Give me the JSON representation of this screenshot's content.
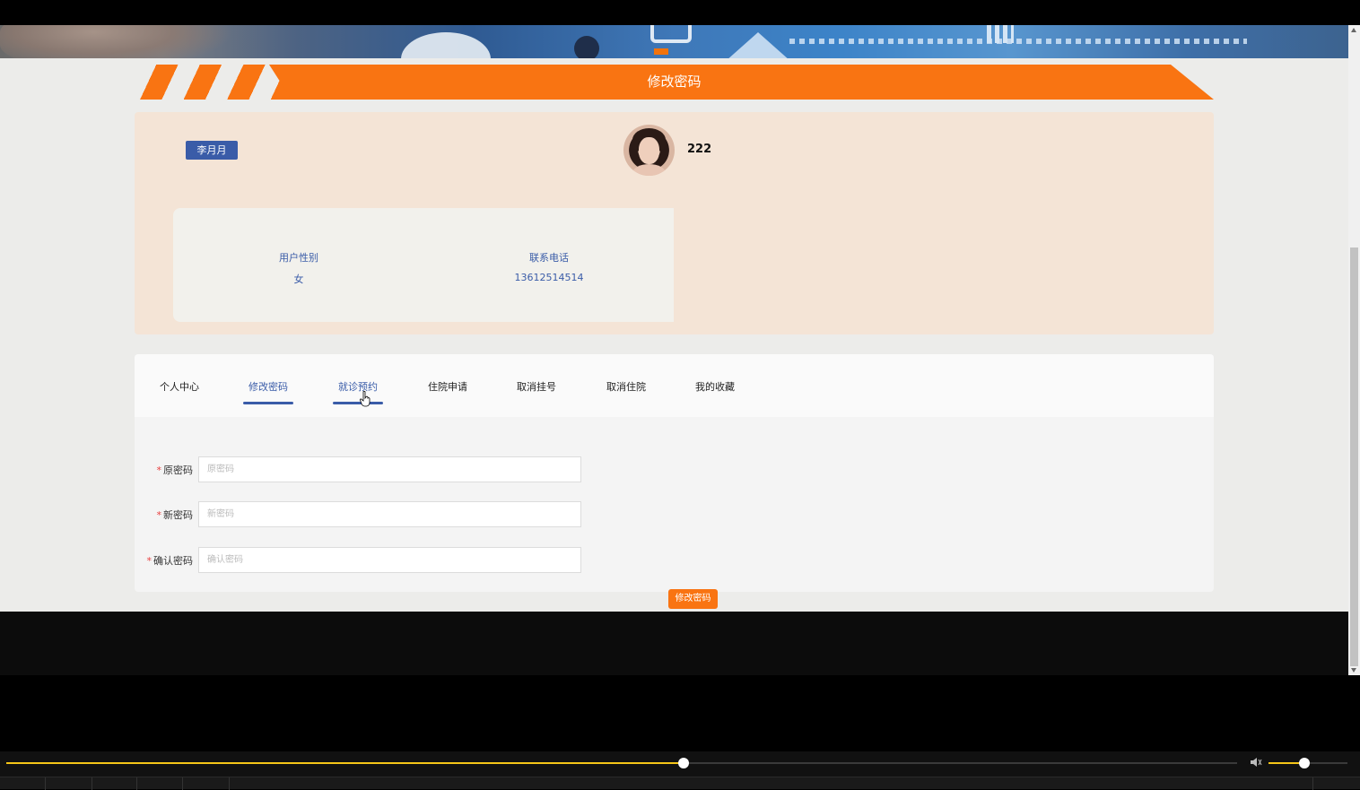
{
  "page": {
    "title": "修改密码"
  },
  "profile": {
    "name_badge": "李月月",
    "username": "222",
    "fields": [
      {
        "label": "用户性别",
        "value": "女"
      },
      {
        "label": "联系电话",
        "value": "13612514514"
      }
    ]
  },
  "tabs": [
    {
      "label": "个人中心",
      "active": false
    },
    {
      "label": "修改密码",
      "active": true
    },
    {
      "label": "就诊预约",
      "active": false,
      "hover": true
    },
    {
      "label": "住院申请",
      "active": false
    },
    {
      "label": "取消挂号",
      "active": false
    },
    {
      "label": "取消住院",
      "active": false
    },
    {
      "label": "我的收藏",
      "active": false
    }
  ],
  "form": {
    "required_mark": "*",
    "fields": [
      {
        "label": "原密码",
        "placeholder": "原密码"
      },
      {
        "label": "新密码",
        "placeholder": "新密码"
      },
      {
        "label": "确认密码",
        "placeholder": "确认密码"
      }
    ],
    "submit_label": "修改密码"
  },
  "player": {
    "progress": 0.55,
    "volume": 0.45
  },
  "colors": {
    "accent_orange": "#f97412",
    "accent_blue": "#3a5ca8",
    "profile_bg": "#f4e4d6",
    "seek_color": "#f5c518"
  }
}
